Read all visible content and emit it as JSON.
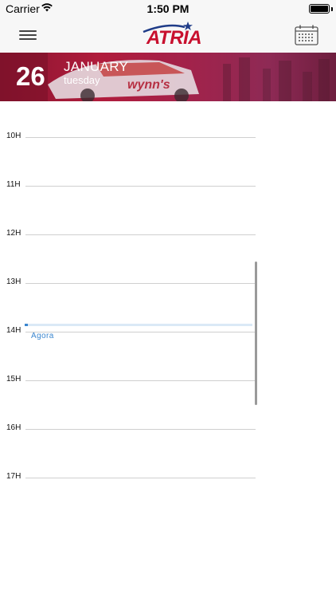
{
  "status_bar": {
    "carrier": "Carrier",
    "time": "1:50 PM"
  },
  "nav": {
    "logo_text": "ATRIA",
    "menu_icon": "hamburger-menu-icon",
    "calendar_icon": "calendar-icon"
  },
  "header": {
    "day": "26",
    "month": "JANUARY",
    "weekday": "tuesday"
  },
  "schedule": {
    "hours": [
      "10H",
      "11H",
      "12H",
      "13H",
      "14H",
      "15H",
      "16H",
      "17H"
    ],
    "now_label": "Agora"
  },
  "colors": {
    "brand_red": "#c8102e",
    "now_blue": "#3a86cf"
  }
}
